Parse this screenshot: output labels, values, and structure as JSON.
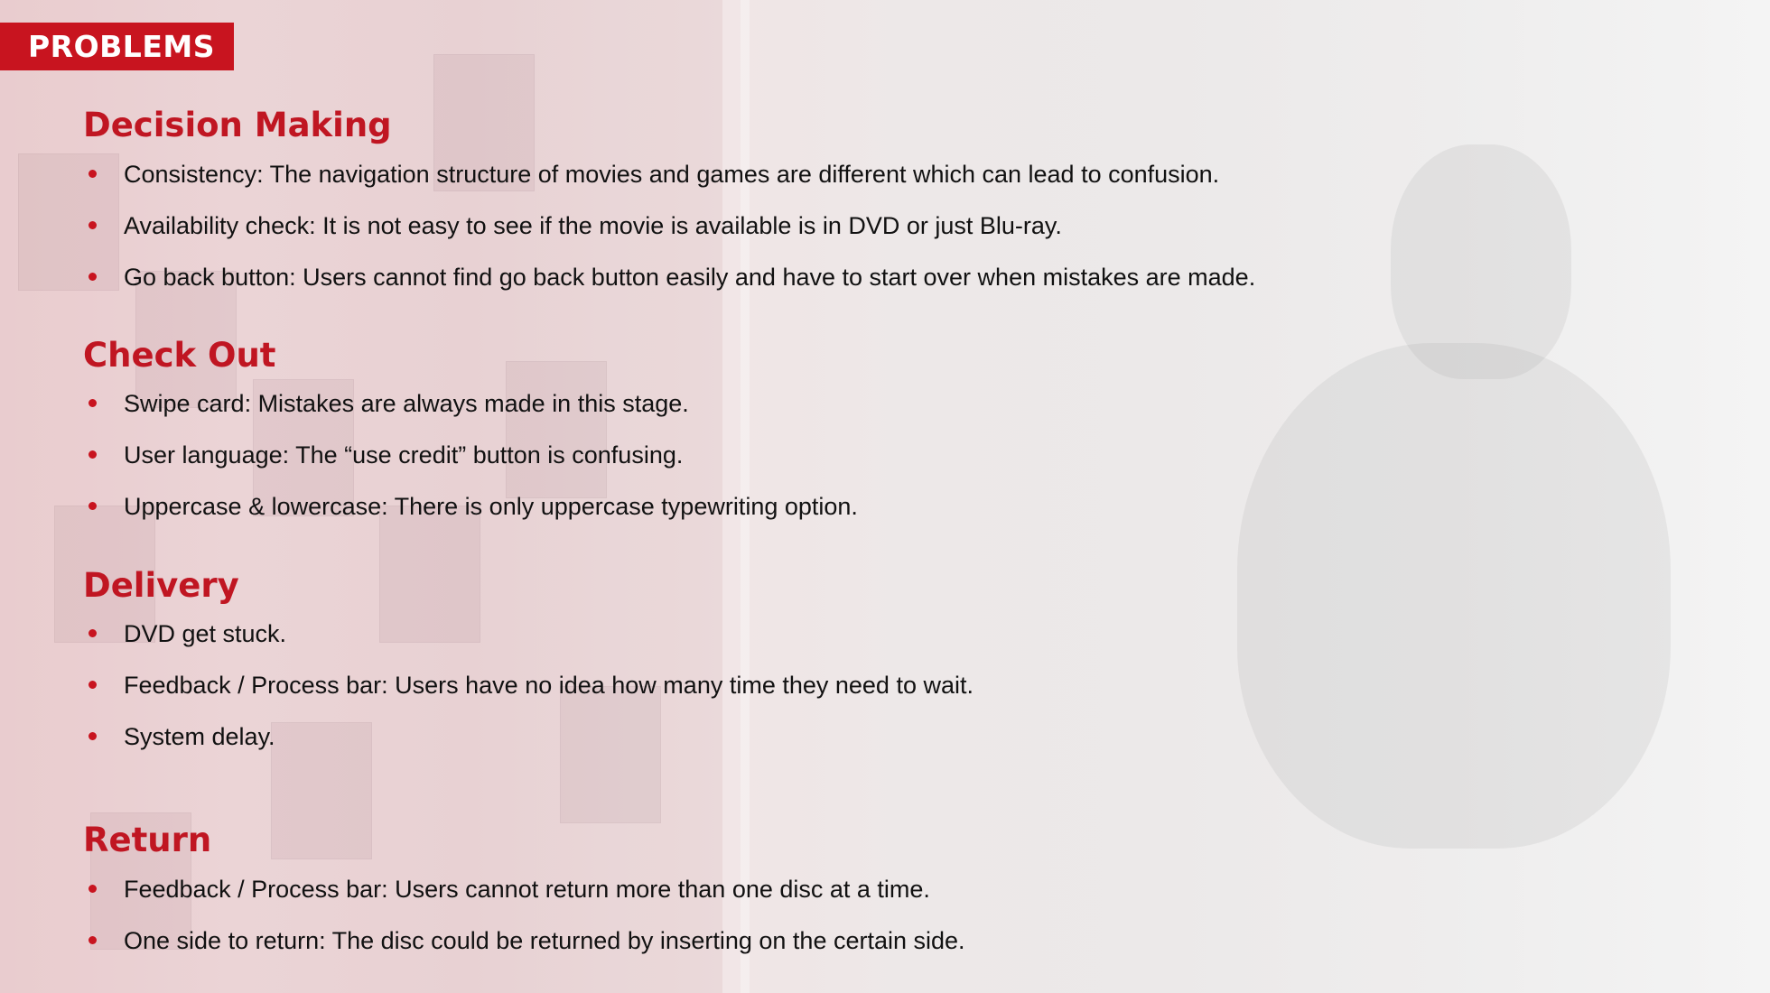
{
  "title": "PROBLEMS",
  "sections": [
    {
      "heading": "Decision Making",
      "items": [
        "Consistency: The navigation structure of movies and games are different which can lead to confusion.",
        "Availability check: It is not easy to see if the movie is available is in DVD or just Blu-ray.",
        "Go back button: Users cannot find go back button easily and have to start over when mistakes are made."
      ]
    },
    {
      "heading": "Check Out",
      "items": [
        "Swipe card: Mistakes are always made in this stage.",
        "User language: The “use credit” button is confusing.",
        "Uppercase & lowercase: There is only uppercase typewriting option."
      ]
    },
    {
      "heading": "Delivery",
      "items": [
        "DVD get stuck.",
        "Feedback /  Process bar: Users have no idea how many time they need to wait.",
        "System delay."
      ]
    },
    {
      "heading": "Return",
      "items": [
        "Feedback / Process bar: Users cannot return more than one disc at a time.",
        "One side to return: The disc could be returned by inserting on the certain side."
      ]
    }
  ],
  "colors": {
    "accent": "#c8141f",
    "heading": "#c01622",
    "text": "#111111"
  }
}
